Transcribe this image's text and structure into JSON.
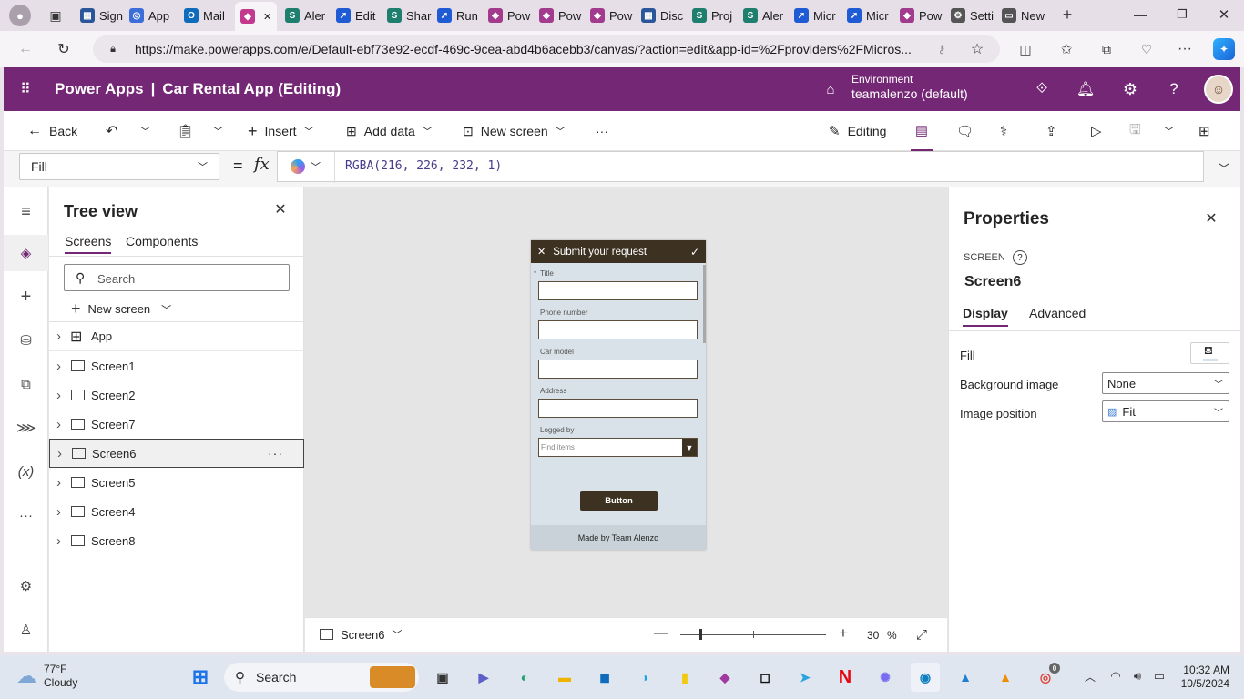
{
  "browser": {
    "tabs": [
      {
        "label": "Sign",
        "color": "#2b579a",
        "glyph": "▦"
      },
      {
        "label": "App",
        "color": "#3b6ed9",
        "glyph": "◎"
      },
      {
        "label": "Mail",
        "color": "#0f6cbd",
        "glyph": "O"
      },
      {
        "label": "",
        "color": "#c2398d",
        "glyph": "◆"
      },
      {
        "label": "Aler",
        "color": "#1f7f6f",
        "glyph": "S"
      },
      {
        "label": "Edit",
        "color": "#1e5bd4",
        "glyph": "➚"
      },
      {
        "label": "Shar",
        "color": "#1f7f6f",
        "glyph": "S"
      },
      {
        "label": "Run",
        "color": "#1e5bd4",
        "glyph": "➚"
      },
      {
        "label": "Pow",
        "color": "#a23a8d",
        "glyph": "◆"
      },
      {
        "label": "Pow",
        "color": "#a23a8d",
        "glyph": "◆"
      },
      {
        "label": "Pow",
        "color": "#a23a8d",
        "glyph": "◆"
      },
      {
        "label": "Disc",
        "color": "#2b579a",
        "glyph": "▦"
      },
      {
        "label": "Proj",
        "color": "#1f7f6f",
        "glyph": "S"
      },
      {
        "label": "Aler",
        "color": "#1f7f6f",
        "glyph": "S"
      },
      {
        "label": "Micr",
        "color": "#1e5bd4",
        "glyph": "➚"
      },
      {
        "label": "Micr",
        "color": "#1e5bd4",
        "glyph": "➚"
      },
      {
        "label": "Pow",
        "color": "#a23a8d",
        "glyph": "◆"
      },
      {
        "label": "Setti",
        "color": "#555555",
        "glyph": "⚙"
      },
      {
        "label": "New",
        "color": "#555555",
        "glyph": "▭"
      }
    ],
    "url": "https://make.powerapps.com/e/Default-ebf73e92-ecdf-469c-9cea-abd4b6acebb3/canvas/?action=edit&app-id=%2Fproviders%2FMicros..."
  },
  "header": {
    "product": "Power Apps",
    "separator": "|",
    "app_title": "Car Rental App (Editing)",
    "env_label": "Environment",
    "env_name": "teamalenzo (default)"
  },
  "commands": {
    "back": "Back",
    "insert": "Insert",
    "add_data": "Add data",
    "new_screen": "New screen",
    "more": "···",
    "editing": "Editing"
  },
  "formula": {
    "property": "Fill",
    "equals": "=",
    "fx": "fx",
    "expression": "RGBA(216, 226, 232, 1)"
  },
  "tree": {
    "title": "Tree view",
    "tabs": [
      "Screens",
      "Components"
    ],
    "search_placeholder": "Search",
    "new_screen": "New screen",
    "items": [
      "App",
      "Screen1",
      "Screen2",
      "Screen7",
      "Screen6",
      "Screen5",
      "Screen4",
      "Screen8"
    ],
    "selected": "Screen6",
    "more": "···"
  },
  "app_screen": {
    "title": "Submit your request",
    "fields": [
      {
        "label": "Title",
        "required": "*"
      },
      {
        "label": "Phone number"
      },
      {
        "label": "Car model"
      },
      {
        "label": "Address"
      },
      {
        "label": "Logged by"
      }
    ],
    "combo_placeholder": "Find items",
    "button": "Button",
    "footer": "Made by Team Alenzo"
  },
  "bottom": {
    "screen": "Screen6",
    "zoom": "30",
    "percent": "%",
    "zoom_level": 0.3
  },
  "properties": {
    "title": "Properties",
    "type": "SCREEN",
    "name": "Screen6",
    "tabs": [
      "Display",
      "Advanced"
    ],
    "fill_label": "Fill",
    "bg_label": "Background image",
    "bg_value": "None",
    "pos_label": "Image position",
    "pos_value": "Fit",
    "fill_color": "#D8E2E8"
  },
  "taskbar": {
    "temp": "77°F",
    "weather": "Cloudy",
    "search": "Search",
    "time": "10:32 AM",
    "date": "10/5/2024",
    "chrome_badge": "0"
  },
  "colors": {
    "brand": "#742774",
    "app_header": "#3d3122",
    "app_bg": "#d8e2e8"
  }
}
